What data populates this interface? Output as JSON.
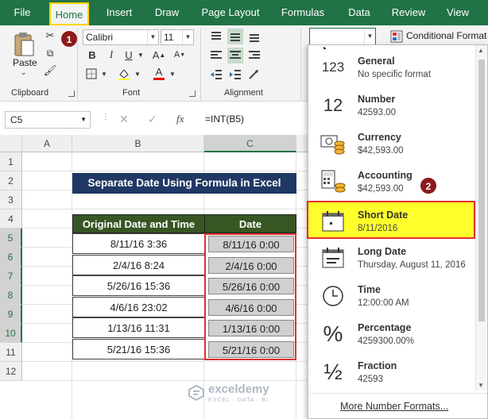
{
  "tabs": [
    "File",
    "Home",
    "Insert",
    "Draw",
    "Page Layout",
    "Formulas",
    "Data",
    "Review",
    "View"
  ],
  "ribbon": {
    "paste_label": "Paste",
    "font_name": "Calibri",
    "font_size": "11",
    "bold": "B",
    "italic": "I",
    "underline": "U",
    "grow_font": "A",
    "shrink_font": "A",
    "font_color_label": "A",
    "conditional_formatting": "Conditional Format",
    "groups": {
      "clipboard": "Clipboard",
      "font": "Font",
      "alignment": "Alignment"
    },
    "number_format_value": ""
  },
  "annotations": {
    "badge1": "1",
    "badge2": "2"
  },
  "formula_bar": {
    "name_box": "C5",
    "fx": "fx",
    "formula": "=INT(B5)"
  },
  "grid": {
    "columns": [
      "A",
      "B",
      "C"
    ],
    "rows": [
      "1",
      "2",
      "3",
      "4",
      "5",
      "6",
      "7",
      "8",
      "9",
      "10",
      "11",
      "12"
    ],
    "title": "Separate Date Using Formula in Excel",
    "header_original": "Original Date and Time",
    "header_date": "Date",
    "original": [
      "8/11/16 3:36",
      "2/4/16 8:24",
      "5/26/16 15:36",
      "4/6/16 23:02",
      "1/13/16 11:31",
      "5/21/16 15:36"
    ],
    "date": [
      "8/11/16 0:00",
      "2/4/16 0:00",
      "5/26/16 0:00",
      "4/6/16 0:00",
      "1/13/16 0:00",
      "5/21/16 0:00"
    ]
  },
  "number_formats": [
    {
      "name": "General",
      "example": "No specific format",
      "icon": "general-123-icon"
    },
    {
      "name": "Number",
      "example": "42593.00",
      "icon": "number-12-icon"
    },
    {
      "name": "Currency",
      "example": "$42,593.00",
      "icon": "currency-icon"
    },
    {
      "name": "Accounting",
      "example": " $42,593.00",
      "icon": "accounting-icon"
    },
    {
      "name": "Short Date",
      "example": "8/11/2016",
      "icon": "short-date-calendar-icon"
    },
    {
      "name": "Long Date",
      "example": "Thursday, August 11, 2016",
      "icon": "long-date-calendar-icon"
    },
    {
      "name": "Time",
      "example": "12:00:00 AM",
      "icon": "clock-icon"
    },
    {
      "name": "Percentage",
      "example": "4259300.00%",
      "icon": "percent-icon"
    },
    {
      "name": "Fraction",
      "example": "42593",
      "icon": "fraction-icon"
    }
  ],
  "icon_glyphs": {
    "general": "123",
    "number": "12",
    "percent": "%",
    "fraction": "½"
  },
  "more_formats": "More Number Formats...",
  "watermark": {
    "brand": "exceldemy",
    "tagline": "EXCEL · DATA · BI"
  },
  "colors": {
    "excel_green": "#217346",
    "title_fill": "#1f3864",
    "header_fill": "#375623",
    "highlight": "#ffff2b",
    "annotation_red": "#e0302f"
  }
}
